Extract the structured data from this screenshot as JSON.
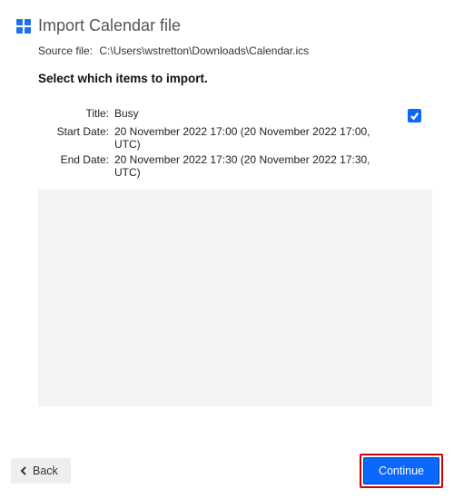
{
  "header": {
    "title": "Import Calendar file"
  },
  "source": {
    "label": "Source file:",
    "path": "C:\\Users\\wstretton\\Downloads\\Calendar.ics"
  },
  "instruction": "Select which items to import.",
  "fields": {
    "title_label": "Title:",
    "start_label": "Start Date:",
    "end_label": "End Date:"
  },
  "items": [
    {
      "title": "Busy",
      "start": "20 November 2022 17:00 (20 November 2022 17:00, UTC)",
      "end": "20 November 2022 17:30 (20 November 2022 17:30, UTC)",
      "checked": true
    }
  ],
  "buttons": {
    "back": "Back",
    "continue": "Continue"
  }
}
